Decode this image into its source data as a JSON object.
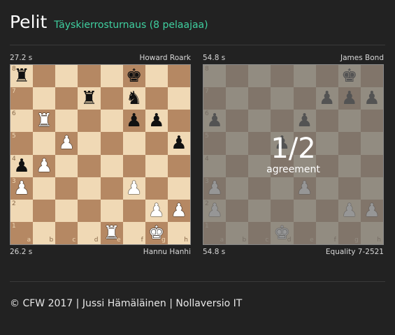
{
  "header": {
    "title": "Pelit",
    "subtitle": "Täyskierrosturnaus (8 pelaajaa)"
  },
  "files": [
    "a",
    "b",
    "c",
    "d",
    "e",
    "f",
    "g",
    "h"
  ],
  "ranks": [
    "8",
    "7",
    "6",
    "5",
    "4",
    "3",
    "2",
    "1"
  ],
  "games": [
    {
      "top_player": {
        "time": "27.2 s",
        "name": "Howard Roark"
      },
      "bottom_player": {
        "time": "26.2 s",
        "name": "Hannu Hanhi"
      },
      "position": [
        "r....k..",
        "...r.n..",
        ".R...pp.",
        "..P....p",
        "pP......",
        "P....P..",
        "......PP",
        "....R.K."
      ],
      "result": null
    },
    {
      "top_player": {
        "time": "54.8 s",
        "name": "James Bond"
      },
      "bottom_player": {
        "time": "54.8 s",
        "name": "Equality 7-2521"
      },
      "position": [
        "......k.",
        ".....ppp",
        "p...p...",
        "...p....",
        "........",
        "P...P...",
        "P.....PP",
        "...K...."
      ],
      "result": {
        "score": "1/2",
        "reason": "agreement"
      }
    }
  ],
  "footer": {
    "text": "© CFW 2017 | Jussi Hämäläinen | Nollaversio IT"
  }
}
